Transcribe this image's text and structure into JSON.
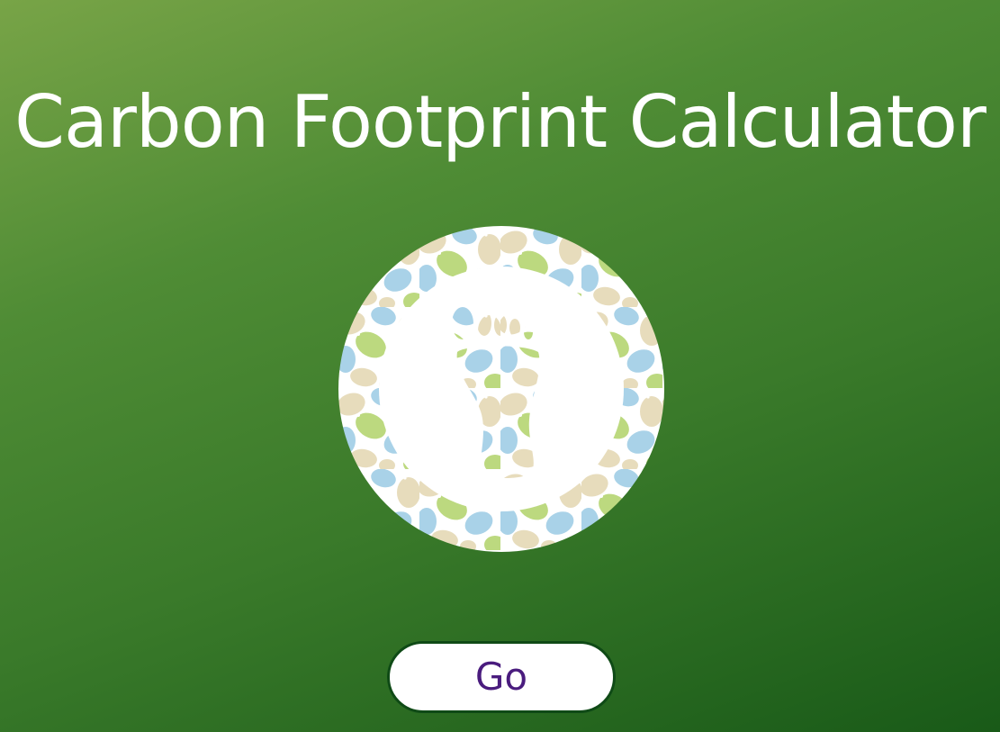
{
  "page": {
    "title": "Carbon Footprint Calculator"
  },
  "logo": {
    "icon": "footprint-icon",
    "pattern_colors": [
      "#a9d2e8",
      "#e7dcbc",
      "#bcd97f",
      "#ffffff"
    ]
  },
  "actions": {
    "go_label": "Go"
  },
  "colors": {
    "background_start": "#78a447",
    "background_end": "#195a18",
    "button_text": "#4a1c7e",
    "button_border": "#0f4a16"
  }
}
